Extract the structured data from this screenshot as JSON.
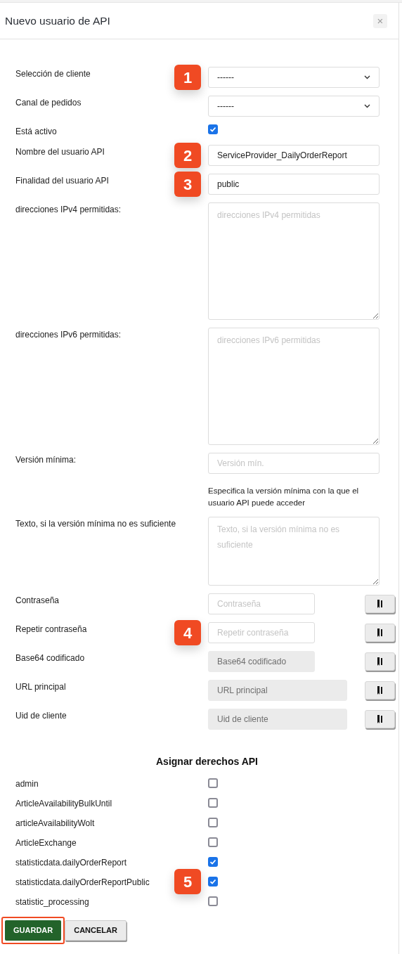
{
  "dialog": {
    "title": "Nuevo usuario de API",
    "close_label": "×"
  },
  "fields": [
    {
      "kind": "select",
      "label": "Selección de cliente",
      "value": "------",
      "badge": "1"
    },
    {
      "kind": "select",
      "label": "Canal de pedidos",
      "value": "------"
    },
    {
      "kind": "checkbox",
      "label": "Está activo",
      "checked": true
    },
    {
      "kind": "text",
      "label": "Nombre del usuario API",
      "value": "ServiceProvider_DailyOrderReport",
      "badge": "2"
    },
    {
      "kind": "text",
      "label": "Finalidad del usuario API",
      "value": "public",
      "badge": "3"
    },
    {
      "kind": "textarea",
      "label": "direcciones IPv4 permitidas:",
      "placeholder": "direcciones IPv4 permitidas"
    },
    {
      "kind": "textarea",
      "label": "direcciones IPv6 permitidas:",
      "placeholder": "direcciones IPv6 permitidas"
    },
    {
      "kind": "text",
      "label": "Versión mínima:",
      "placeholder": "Versión mín.",
      "help": "Especifica la versión mínima con la que el usuario API puede acceder"
    },
    {
      "kind": "note",
      "label": "Texto, si la versión mínima no es suficiente",
      "placeholder": "Texto, si la versión mínima no es suficiente"
    },
    {
      "kind": "copy",
      "label": "Contraseña",
      "placeholder": "Contraseña",
      "disabled": false
    },
    {
      "kind": "copy",
      "label": "Repetir contraseña",
      "placeholder": "Repetir contraseña",
      "disabled": false,
      "badge": "4"
    },
    {
      "kind": "copy",
      "label": "Base64 codificado",
      "placeholder": "Base64 codificado",
      "disabled": true
    },
    {
      "kind": "copy_wide",
      "label": "URL principal",
      "placeholder": "URL principal",
      "disabled": true
    },
    {
      "kind": "copy_wide",
      "label": "Uid de cliente",
      "placeholder": "Uid de cliente",
      "disabled": true
    }
  ],
  "rights": {
    "heading": "Asignar derechos API",
    "items": [
      {
        "label": "admin",
        "checked": false
      },
      {
        "label": "ArticleAvailabilityBulkUntil",
        "checked": false
      },
      {
        "label": "articleAvailabilityWolt",
        "checked": false
      },
      {
        "label": "ArticleExchange",
        "checked": false
      },
      {
        "label": "statisticdata.dailyOrderReport",
        "checked": true
      },
      {
        "label": "statisticdata.dailyOrderReportPublic",
        "checked": true,
        "badge": "5"
      },
      {
        "label": "statistic_processing",
        "checked": false
      }
    ]
  },
  "buttons": [
    {
      "kind": "primary",
      "label": "GUARDAR",
      "highlighted": true
    },
    {
      "kind": "secondary",
      "label": "CANCELAR",
      "highlighted": false
    }
  ]
}
